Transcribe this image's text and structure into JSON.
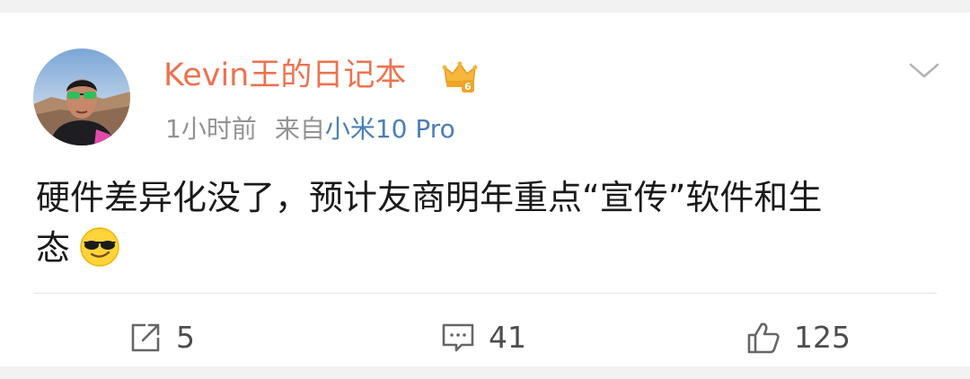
{
  "post": {
    "username": "Kevin王的日记本",
    "time": "1小时前",
    "source_prefix": "来自",
    "source": "小米10 Pro",
    "text_line1": "硬件差异化没了，预计友商明年重点“宣传”软件和生",
    "text_line2": "态",
    "emoji": "cool-sunglasses-emoji"
  },
  "actions": {
    "repost_count": "5",
    "comment_count": "41",
    "like_count": "125"
  },
  "colors": {
    "username": "#eb7350",
    "source_link": "#4a7fb5",
    "meta": "#939393",
    "divider": "#e6e6e6"
  }
}
